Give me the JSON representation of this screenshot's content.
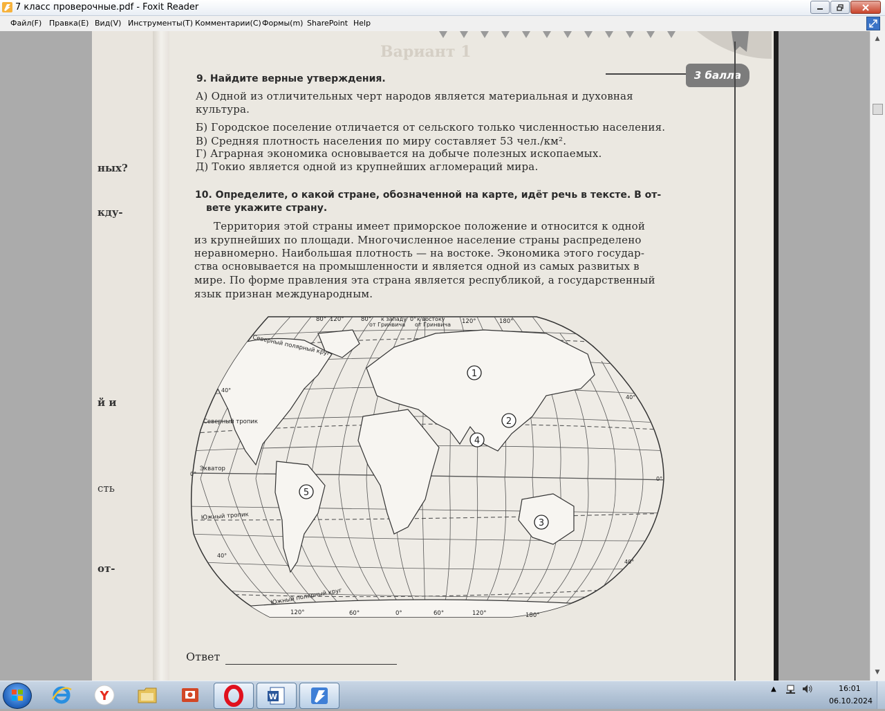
{
  "window": {
    "title": "7 класс проверочные.pdf - Foxit Reader"
  },
  "menu": [
    {
      "label": "Файл(F)"
    },
    {
      "label": "Правка(E)"
    },
    {
      "label": "Вид(V)"
    },
    {
      "label": "Инструменты(T)"
    },
    {
      "label": "Комментарии(C)"
    },
    {
      "label": "Формы(m)"
    },
    {
      "label": "SharePoint"
    },
    {
      "label": "Help"
    }
  ],
  "page": {
    "prev_heading": "Вариант 1",
    "left_fragments": [
      "ных?",
      "кду-",
      "й и",
      "сть",
      "от-"
    ],
    "score_badge": "3 балла",
    "q9": {
      "heading": "9.  Найдите верные утверждения.",
      "lines": [
        "А) Одной из отличительных черт народов является материальная и духовная",
        "культура.",
        "Б) Городское поселение отличается от сельского только численностью населения.",
        "В) Средняя плотность населения по миру составляет 53 чел./км².",
        "Г) Аграрная экономика основывается на добыче полезных ископаемых.",
        "Д) Токио является одной из крупнейших агломераций мира."
      ]
    },
    "q10": {
      "heading_line1": "10. Определите, о какой стране, обозначенной на карте, идёт речь в тексте. В от-",
      "heading_line2": "вете укажите страну.",
      "body": [
        "Территория этой страны имеет приморское положение и относится к одной",
        "из крупнейших по площади. Многочисленное население страны распределено",
        "неравномерно. Наибольшая плотность — на востоке. Экономика этого государ-",
        "ства основывается на промышленности и является одной из самых развитых в",
        "мире. По форме правления эта страна является республикой, а государственный",
        "язык признан международным."
      ]
    },
    "map": {
      "top_labels": {
        "west": "к западу",
        "from_greenwich_w": "от Гринвича",
        "east": "к востоку",
        "from_greenwich_e": "от Гринвича",
        "lon_80w": "80°",
        "lon_120w": "120°",
        "lon_80w_2": "80°",
        "lon_0": "0°",
        "lon_120e": "120°",
        "lon_180": "180°"
      },
      "lines": {
        "arctic_circle_n": "Северный полярный круг",
        "tropic_n": "Северный тропик",
        "equator": "Экватор",
        "tropic_s": "Южный тропик",
        "arctic_circle_s": "Южный полярный круг"
      },
      "lat_labels": {
        "n40_left": "40°",
        "n40_right": "40°",
        "eq_left": "0°",
        "eq_right": "0°",
        "s40_left": "40°",
        "s40_right": "40°"
      },
      "bottom_labels": [
        "120°",
        "60°",
        "0°",
        "60°",
        "120°",
        "180°"
      ],
      "markers": [
        "1",
        "2",
        "3",
        "4",
        "5"
      ]
    },
    "answer_label": "Ответ"
  },
  "taskbar": {
    "apps": [
      "start",
      "internet-explorer",
      "yandex-browser",
      "file-explorer",
      "presentation-app",
      "opera",
      "word",
      "foxit-reader"
    ],
    "clock_time": "16:01",
    "clock_date": "06.10.2024"
  }
}
